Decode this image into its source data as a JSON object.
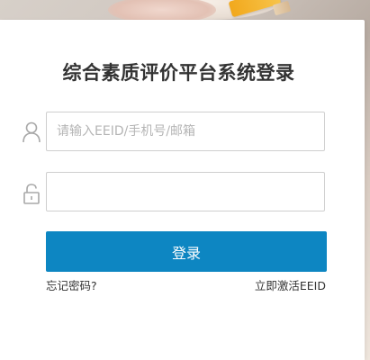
{
  "title": "综合素质评价平台系统登录",
  "username": {
    "placeholder": "请输入EEID/手机号/邮箱",
    "value": "",
    "icon": "user-icon"
  },
  "password": {
    "placeholder": "",
    "value": "",
    "icon": "lock-icon"
  },
  "login_button": "登录",
  "links": {
    "forgot_password": "忘记密码?",
    "activate": "立即激活EEID"
  },
  "colors": {
    "primary": "#0d86c2",
    "title_text": "#333333",
    "input_border": "#cfcfcf",
    "placeholder": "#b5b5b5",
    "icon": "#a8a8a8"
  }
}
